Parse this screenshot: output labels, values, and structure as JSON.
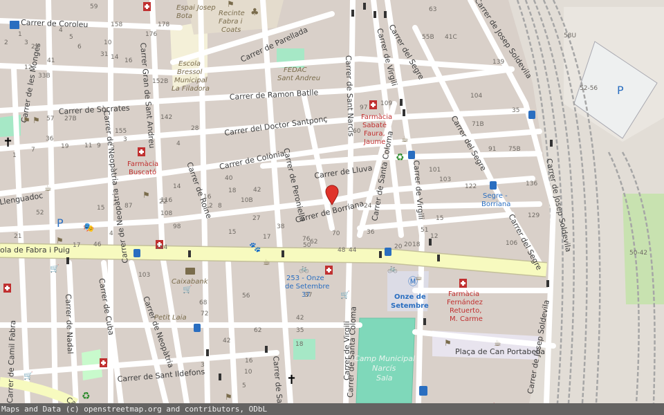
{
  "attribution": "Maps and Data (c) openstreetmap.org and contributors, ODbL",
  "colors": {
    "block": "#d9d0c9",
    "street": "#ffffff",
    "primary_road": "#f7fabf",
    "park": "#c8facc",
    "sports": "#88e0be",
    "railway": "#b8b8b8",
    "pharmacy": "#c03030",
    "transit": "#2a6ec0",
    "marker": "#e0332a"
  },
  "streets": {
    "coroleu": "Carrer de Coroleu",
    "monges": "Carrer de les Monges",
    "neopatria_1": "Carrer de Neopàtria",
    "neopatria_2": "Carrer de Neopàtria",
    "neopatria_3": "Carrer de Neopàtria",
    "gran_sant_andreu": "Carrer Gran de Sant Andreu",
    "parellada": "Carrer de Parellada",
    "ramon_batlle": "Carrer de Ramon Batlle",
    "socrates": "Carrer de Sòcrates",
    "doctor_santponc": "Carrer del Doctor Santponç",
    "colonia": "Carrer de Colònia",
    "lluva": "Carrer de Lluva",
    "peroniella": "Carrer de Peroniella",
    "roine": "Carrer de Roine",
    "llenguadoc": "Llenguadoc",
    "borriana": "Carrer de Borriana",
    "fabra_puig": "ola de Fabra i Puig",
    "sant_narcis": "Carrer de Sant Narcís",
    "virgili_1": "Carrer de Virgili",
    "virgili_2": "Carrer de Virgili",
    "virgili_3": "Carrer de Virgili",
    "segre_1": "Carrer del Segre",
    "segre_2": "Carrer del Segre",
    "segre_3": "Carrer del Segre",
    "josep_soldevila_1": "Carrer de Josep Soldevila",
    "josep_soldevila_2": "Carrer de Josep Soldevila",
    "josep_soldevila_3": "Carrer de Josep Soldevila",
    "santa_coloma_1": "Carrer de Santa Coloma",
    "santa_coloma_2": "Carrer de Santa Coloma",
    "camil_fabra": "Carrer de Camil Fabra",
    "nadal": "Carrer de Nadal",
    "cuba": "Carrer de Cuba",
    "sant_ildefons": "Carrer de Sant Ildefons",
    "sant_adria_partial": "Carrer de Sa",
    "placa_can_portabella": "Plaça de Can Portabella",
    "ca_partial": "Ca"
  },
  "pois": {
    "espai_bota_1": "Espai Josep",
    "espai_bota_2": "Bota",
    "recinte_1": "Recinte",
    "recinte_2": "Fabra i",
    "recinte_3": "Coats",
    "escola_1": "Escola",
    "escola_2": "Bressol",
    "escola_3": "Municipal",
    "escola_4": "La Filadora",
    "fedac_1": "FEDAC",
    "fedac_2": "Sant Andreu",
    "farmacia_sabate_1": "Farmàcia",
    "farmacia_sabate_2": "Sabaté",
    "farmacia_sabate_3": "Faura,",
    "farmacia_sabate_4": "Jaume",
    "farmacia_buscato_1": "Farmàcia",
    "farmacia_buscato_2": "Buscató",
    "segre_borriana_1": "Segre -",
    "segre_borriana_2": "Borriana",
    "onze_setembre_stop_1": "253 - Onze",
    "onze_setembre_stop_2": "de Setembre",
    "onze_setembre_stop_3": "37",
    "caixabank": "Caixabank",
    "petit_laia": "Petit Laia",
    "onze_setembre_1": "Onze de",
    "onze_setembre_2": "Setembre",
    "farmacia_fernandez_1": "Farmàcia",
    "farmacia_fernandez_2": "Fernández",
    "farmacia_fernandez_3": "Retuerto,",
    "farmacia_fernandez_4": "M. Carme",
    "camp_1": "Camp Municipal",
    "camp_2": "Narcís",
    "camp_3": "Sala",
    "parking_p1": "P",
    "parking_p2": "P"
  },
  "house_numbers": [
    {
      "text": "59"
    },
    {
      "text": "158"
    },
    {
      "text": "178"
    },
    {
      "text": "1"
    },
    {
      "text": "4"
    },
    {
      "text": "176"
    },
    {
      "text": "2"
    },
    {
      "text": "3"
    },
    {
      "text": "29"
    },
    {
      "text": "5"
    },
    {
      "text": "6"
    },
    {
      "text": "10"
    },
    {
      "text": "31"
    },
    {
      "text": "33B"
    },
    {
      "text": "152B"
    },
    {
      "text": "12"
    },
    {
      "text": "41"
    },
    {
      "text": "14"
    },
    {
      "text": "16"
    },
    {
      "text": "142"
    },
    {
      "text": "27B"
    },
    {
      "text": "57"
    },
    {
      "text": "155"
    },
    {
      "text": "36"
    },
    {
      "text": "19"
    },
    {
      "text": "11"
    },
    {
      "text": "9"
    },
    {
      "text": "5"
    },
    {
      "text": "3"
    },
    {
      "text": "1"
    },
    {
      "text": "7"
    },
    {
      "text": "4"
    },
    {
      "text": "28"
    },
    {
      "text": "22"
    },
    {
      "text": "16"
    },
    {
      "text": "18"
    },
    {
      "text": "14"
    },
    {
      "text": "40"
    },
    {
      "text": "42"
    },
    {
      "text": "116"
    },
    {
      "text": "108"
    },
    {
      "text": "98"
    },
    {
      "text": "87"
    },
    {
      "text": "8"
    },
    {
      "text": "2"
    },
    {
      "text": "15"
    },
    {
      "text": "27"
    },
    {
      "text": "38"
    },
    {
      "text": "10B"
    },
    {
      "text": "17"
    },
    {
      "text": "76"
    },
    {
      "text": "62"
    },
    {
      "text": "70"
    },
    {
      "text": "50"
    },
    {
      "text": "48"
    },
    {
      "text": "44"
    },
    {
      "text": "24"
    },
    {
      "text": "36"
    },
    {
      "text": "51"
    },
    {
      "text": "15"
    },
    {
      "text": "20"
    },
    {
      "text": "18"
    },
    {
      "text": "12"
    },
    {
      "text": "20"
    },
    {
      "text": "109"
    },
    {
      "text": "97"
    },
    {
      "text": "60"
    },
    {
      "text": "71B"
    },
    {
      "text": "91"
    },
    {
      "text": "75B"
    },
    {
      "text": "104"
    },
    {
      "text": "35"
    },
    {
      "text": "101"
    },
    {
      "text": "103"
    },
    {
      "text": "122"
    },
    {
      "text": "136"
    },
    {
      "text": "129"
    },
    {
      "text": "106"
    },
    {
      "text": "63"
    },
    {
      "text": "55B"
    },
    {
      "text": "41C"
    },
    {
      "text": "139"
    },
    {
      "text": "58U"
    },
    {
      "text": "52-56"
    },
    {
      "text": "50-42"
    },
    {
      "text": "103"
    },
    {
      "text": "68"
    },
    {
      "text": "72"
    },
    {
      "text": "42"
    },
    {
      "text": "35"
    },
    {
      "text": "37"
    },
    {
      "text": "56"
    },
    {
      "text": "42"
    },
    {
      "text": "18"
    },
    {
      "text": "62"
    },
    {
      "text": "16"
    },
    {
      "text": "3"
    },
    {
      "text": "5"
    },
    {
      "text": "10"
    },
    {
      "text": "104"
    },
    {
      "text": "21"
    },
    {
      "text": "17"
    },
    {
      "text": "46"
    },
    {
      "text": "52"
    },
    {
      "text": "15"
    },
    {
      "text": "4"
    },
    {
      "text": "5"
    }
  ]
}
